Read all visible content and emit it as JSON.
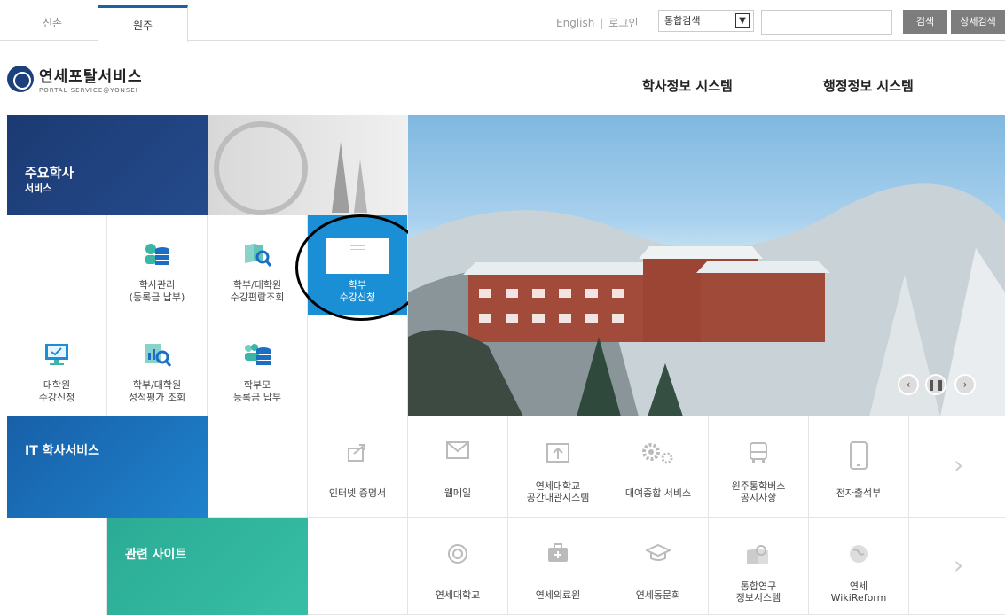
{
  "campus_tabs": [
    "신촌",
    "원주"
  ],
  "top_links": {
    "english": "English",
    "login": "로그인"
  },
  "search": {
    "scope": "통합검색",
    "search_button": "검색",
    "advanced_button": "상세검색"
  },
  "logo": {
    "title": "연세포탈서비스",
    "subtitle": "PORTAL SERVICE@YONSEI"
  },
  "system_nav": [
    "학사정보 시스템",
    "행정정보 시스템"
  ],
  "main_service": {
    "title": "주요학사",
    "subtitle": "서비스",
    "items": [
      {
        "label_1": "학사관리",
        "label_2": "(등록금 납부)"
      },
      {
        "label_1": "학부/대학원",
        "label_2": "수강편람조회"
      },
      {
        "label_1": "학부",
        "label_2": "수강신청"
      },
      {
        "label_1": "대학원",
        "label_2": "수강신청"
      },
      {
        "label_1": "학부/대학원",
        "label_2": "성적평가 조회"
      },
      {
        "label_1": "학부모",
        "label_2": "등록금 납부"
      }
    ]
  },
  "it_service": {
    "title": "IT 학사서비스",
    "items": [
      {
        "label_1": "인터넷 증명서",
        "label_2": ""
      },
      {
        "label_1": "웹메일",
        "label_2": ""
      },
      {
        "label_1": "연세대학교",
        "label_2": "공간대관시스템"
      },
      {
        "label_1": "대여종합 서비스",
        "label_2": ""
      },
      {
        "label_1": "원주통학버스",
        "label_2": "공지사항"
      },
      {
        "label_1": "전자출석부",
        "label_2": ""
      }
    ]
  },
  "related_sites": {
    "title": "관련 사이트",
    "items": [
      {
        "label_1": "연세대학교",
        "label_2": ""
      },
      {
        "label_1": "연세의료원",
        "label_2": ""
      },
      {
        "label_1": "연세동문회",
        "label_2": ""
      },
      {
        "label_1": "통합연구",
        "label_2": "정보시스템"
      },
      {
        "label_1": "연세",
        "label_2": "WikiReform"
      }
    ]
  },
  "slider": {
    "controls": [
      "prev",
      "pause",
      "next"
    ]
  },
  "colors": {
    "dark_blue": "#1b3a72",
    "teal": "#2bab95",
    "highlight_blue": "#1a8fd6",
    "icon_teal": "#3bb6a6"
  }
}
